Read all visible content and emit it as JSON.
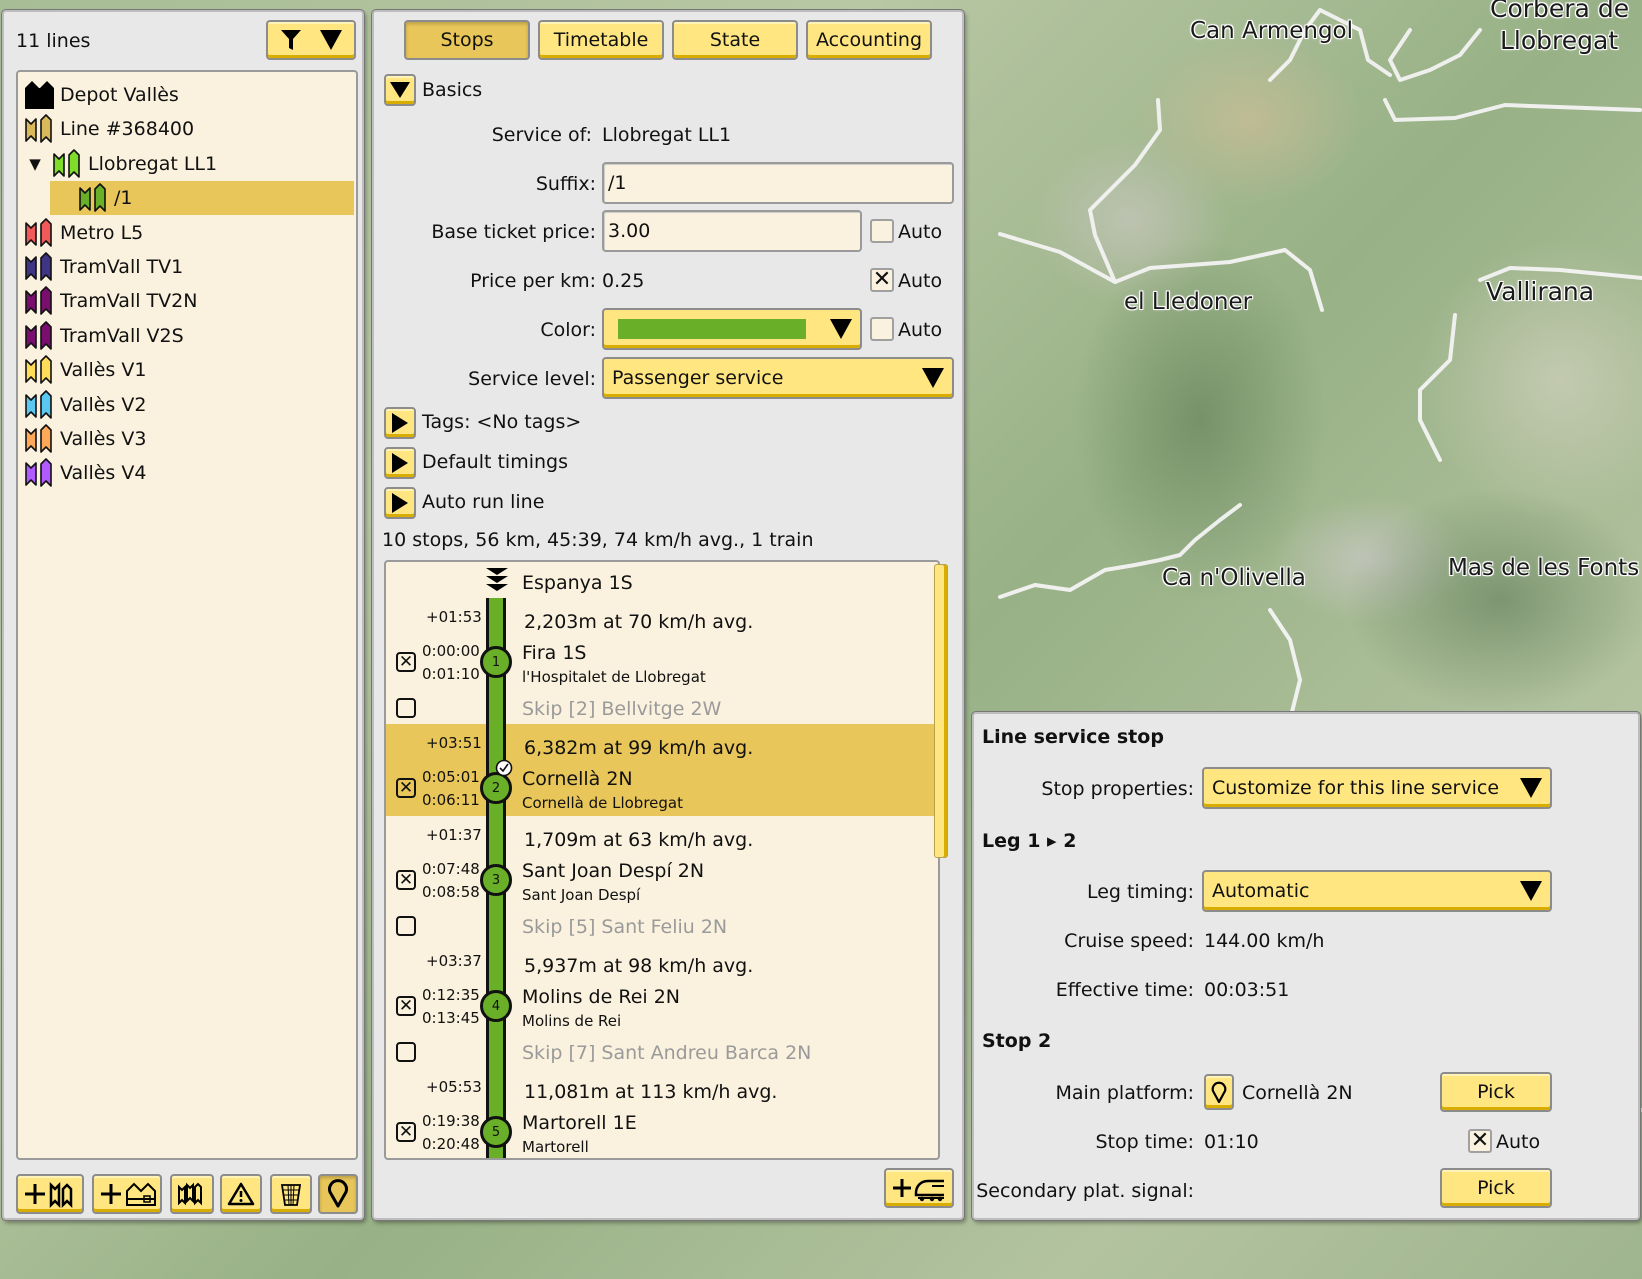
{
  "map": {
    "labels": [
      "Can Armengol",
      "Corbera de",
      "Llobregat",
      "el Lledoner",
      "Vallirana",
      "Ca n'Olivella",
      "Mas de les Fonts"
    ]
  },
  "line_list": {
    "count_label": "11 lines",
    "filter_icon": "filter-icon",
    "items": [
      {
        "label": "Depot Vallès",
        "icon": "depot-icon",
        "color": "#000000",
        "indent": 0
      },
      {
        "label": "Line #368400",
        "icon": "line-icon",
        "color": "#d9b95a",
        "indent": 0
      },
      {
        "label": "Llobregat LL1",
        "icon": "line-icon",
        "color": "#7fdc2a",
        "indent": 1,
        "expanded": true
      },
      {
        "label": "/1",
        "icon": "line-icon",
        "color": "#6aaf28",
        "indent": 2,
        "selected": true
      },
      {
        "label": "Metro L5",
        "icon": "line-icon",
        "color": "#f25a5a",
        "indent": 0
      },
      {
        "label": "TramVall TV1",
        "icon": "line-icon",
        "color": "#3e3585",
        "indent": 0
      },
      {
        "label": "TramVall TV2N",
        "icon": "line-icon",
        "color": "#7a0e6f",
        "indent": 0
      },
      {
        "label": "TramVall V2S",
        "icon": "line-icon",
        "color": "#7a0e6f",
        "indent": 0
      },
      {
        "label": "Vallès V1",
        "icon": "line-icon",
        "color": "#ffdd5a",
        "indent": 0
      },
      {
        "label": "Vallès V2",
        "icon": "line-icon",
        "color": "#5ac8f0",
        "indent": 0
      },
      {
        "label": "Vallès V3",
        "icon": "line-icon",
        "color": "#ffa85a",
        "indent": 0
      },
      {
        "label": "Vallès V4",
        "icon": "line-icon",
        "color": "#b05aff",
        "indent": 0
      }
    ],
    "toolbar": [
      "add-line-icon",
      "add-depot-icon",
      "lines-overview-icon",
      "warning-icon",
      "trash-icon",
      "location-pin-icon"
    ]
  },
  "service": {
    "tabs": [
      {
        "label": "Stops",
        "active": true
      },
      {
        "label": "Timetable",
        "active": false
      },
      {
        "label": "State",
        "active": false
      },
      {
        "label": "Accounting",
        "active": false
      }
    ],
    "basics_label": "Basics",
    "service_of_label": "Service of:",
    "service_of_value": "Llobregat LL1",
    "suffix_label": "Suffix:",
    "suffix_value": "/1",
    "base_price_label": "Base ticket price:",
    "base_price_value": "3.00",
    "base_price_auto": false,
    "price_km_label": "Price per km:",
    "price_km_value": "0.25",
    "price_km_auto": true,
    "color_label": "Color:",
    "color_value": "#6aaf28",
    "color_auto": false,
    "auto_label": "Auto",
    "service_level_label": "Service level:",
    "service_level_value": "Passenger service",
    "tags_label": "Tags: <No tags>",
    "default_timings_label": "Default timings",
    "auto_run_label": "Auto run line",
    "summary": "10 stops, 56 km, 45:39, 74 km/h avg., 1 train",
    "stops": {
      "origin": "Espanya 1S",
      "legs": [
        {
          "delta": "+01:53",
          "desc": "2,203m at 70 km/h avg."
        },
        {
          "delta": "+03:51",
          "desc": "6,382m at 99 km/h avg."
        },
        {
          "delta": "+01:37",
          "desc": "1,709m at 63 km/h avg."
        },
        {
          "delta": "+03:37",
          "desc": "5,937m at 98 km/h avg."
        },
        {
          "delta": "+05:53",
          "desc": "11,081m at 113 km/h avg."
        }
      ],
      "items": [
        {
          "num": "1",
          "name": "Fira 1S",
          "town": "l'Hospitalet de Llobregat",
          "arrive": "0:00:00",
          "depart": "0:01:10",
          "checked": true
        },
        {
          "num": "2",
          "name": "Cornellà 2N",
          "town": "Cornellà de Llobregat",
          "arrive": "0:05:01",
          "depart": "0:06:11",
          "checked": true,
          "selected": true
        },
        {
          "num": "3",
          "name": "Sant Joan Despí 2N",
          "town": "Sant Joan Despí",
          "arrive": "0:07:48",
          "depart": "0:08:58",
          "checked": true
        },
        {
          "num": "4",
          "name": "Molins de Rei 2N",
          "town": "Molins de Rei",
          "arrive": "0:12:35",
          "depart": "0:13:45",
          "checked": true
        },
        {
          "num": "5",
          "name": "Martorell 1E",
          "town": "Martorell",
          "arrive": "0:19:38",
          "depart": "0:20:48",
          "checked": true
        }
      ],
      "skips": [
        {
          "label": "Skip [2] Bellvitge 2W",
          "checked": false
        },
        {
          "label": "Skip [5] Sant Feliu 2N",
          "checked": false
        },
        {
          "label": "Skip [7] Sant Andreu Barca 2N",
          "checked": false
        }
      ]
    }
  },
  "stop_details": {
    "title": "Line service stop",
    "stop_properties_label": "Stop properties:",
    "stop_properties_value": "Customize for this line service",
    "leg_title": "Leg 1 ▸ 2",
    "leg_timing_label": "Leg timing:",
    "leg_timing_value": "Automatic",
    "cruise_speed_label": "Cruise speed:",
    "cruise_speed_value": "144.00 km/h",
    "effective_time_label": "Effective time:",
    "effective_time_value": "00:03:51",
    "stop_title": "Stop 2",
    "main_platform_label": "Main platform:",
    "main_platform_value": "Cornellà 2N",
    "pick_label": "Pick",
    "stop_time_label": "Stop time:",
    "stop_time_value": "01:10",
    "stop_time_auto": true,
    "auto_label": "Auto",
    "secondary_signal_label": "Secondary plat. signal:"
  }
}
